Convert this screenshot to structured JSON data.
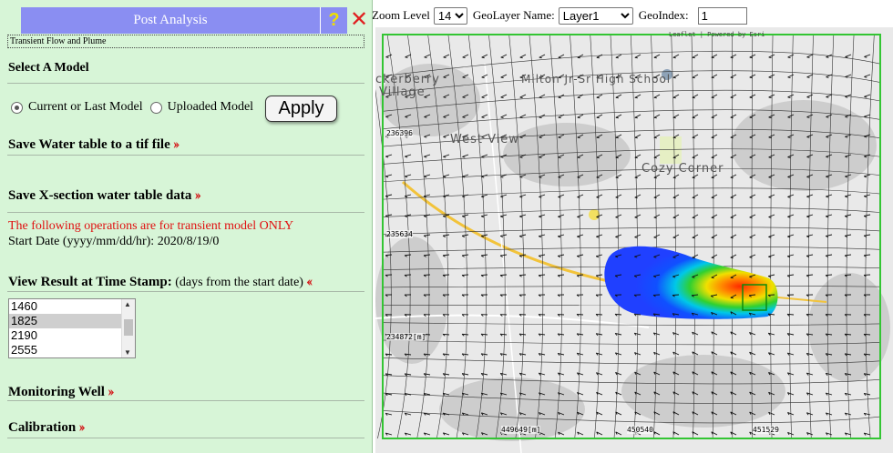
{
  "toolbar": {
    "zoom_label": "Zoom Level",
    "zoom_value": "14",
    "geolayer_label": "GeoLayer Name:",
    "geolayer_value": "Layer1",
    "geoindex_label": "GeoIndex:",
    "geoindex_value": "1"
  },
  "panel": {
    "title": "Post Analysis",
    "help_label": "?",
    "close_label": "✕",
    "subtitle": "Transient Flow and Plume",
    "select_model_heading": "Select A Model",
    "radio_current": "Current or Last Model",
    "radio_uploaded": "Uploaded Model",
    "apply_label": "Apply",
    "save_water_table": "Save Water table to a tif file",
    "save_xsection": "Save X-section water table data",
    "transient_note": "The following operations are for transient model ONLY",
    "start_date": "Start Date (yyyy/mm/dd/hr): 2020/8/19/0",
    "view_result_bold": "View Result at Time Stamp:",
    "view_result_rest": " (days from the start date)",
    "timestamps": [
      "1460",
      "1825",
      "2190",
      "2555"
    ],
    "selected_timestamp": "1825",
    "monitoring_well": "Monitoring Well",
    "calibration": "Calibration",
    "chev_right": "››",
    "chev_left": "‹‹"
  },
  "map": {
    "places": [
      "ckerberry",
      "Village",
      "Milton Jr-Sr High School",
      "West View",
      "Cozy Corner"
    ],
    "y_coords": [
      "236396",
      "235634",
      "234872[m]"
    ],
    "x_coords": [
      "449649[m]",
      "450540",
      "451529"
    ],
    "attribution": "Leaflet | Powered by Esri"
  }
}
